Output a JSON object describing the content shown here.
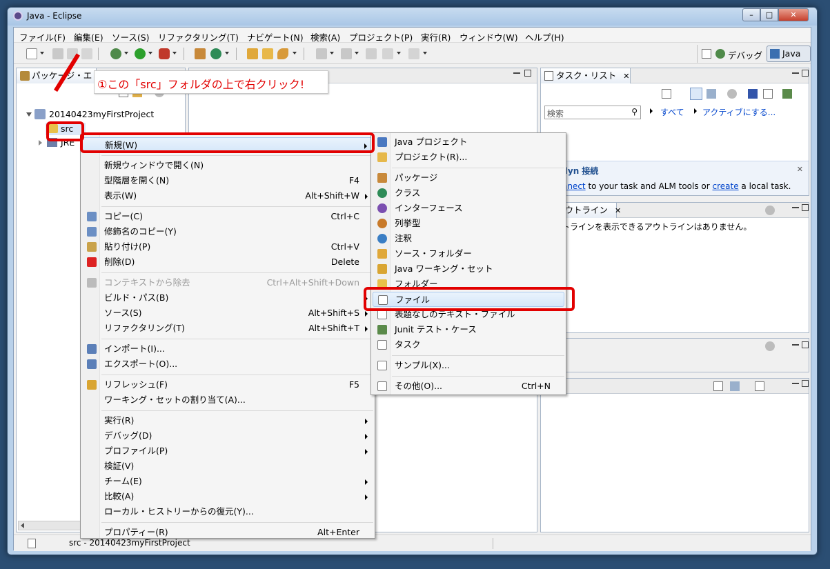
{
  "window": {
    "title": "Java - Eclipse",
    "minimize": "–",
    "maximize": "□",
    "close": "✕"
  },
  "menubar": [
    "ファイル(F)",
    "編集(E)",
    "ソース(S)",
    "リファクタリング(T)",
    "ナビゲート(N)",
    "検索(A)",
    "プロジェクト(P)",
    "実行(R)",
    "ウィンドウ(W)",
    "ヘルプ(H)"
  ],
  "perspectives": {
    "debug": "デバッグ",
    "java": "Java"
  },
  "package_explorer": {
    "tab": "パッケージ・エ",
    "project": "20140423myFirstProject",
    "src": "src",
    "jre": "JRE"
  },
  "annotation": {
    "text": "①この「src」フォルダの上で右クリック!"
  },
  "task_list": {
    "tab": "タスク・リスト",
    "search_placeholder": "検索",
    "all": "すべて",
    "activate": "アクティブにする...",
    "mylyn_title": "Mylyn 接続",
    "mylyn_connect": "Connect",
    "mylyn_text1": " to your task and ALM tools or ",
    "mylyn_create": "create",
    "mylyn_text2": " a local task."
  },
  "outline": {
    "tab": "アウトライン",
    "message": "アウトラインを表示できるアウトラインはありません。"
  },
  "context_menu": [
    {
      "label": "新規(W)",
      "shortcut": "",
      "arrow": true,
      "icon": "",
      "highlight": true
    },
    {
      "sep": true
    },
    {
      "label": "新規ウィンドウで開く(N)",
      "shortcut": ""
    },
    {
      "label": "型階層を開く(N)",
      "shortcut": "F4"
    },
    {
      "label": "表示(W)",
      "shortcut": "Alt+Shift+W",
      "arrow": true
    },
    {
      "sep": true
    },
    {
      "label": "コピー(C)",
      "shortcut": "Ctrl+C",
      "icon": "copy-icon"
    },
    {
      "label": "修飾名のコピー(Y)",
      "shortcut": "",
      "icon": "copy-qualified-icon"
    },
    {
      "label": "貼り付け(P)",
      "shortcut": "Ctrl+V",
      "icon": "paste-icon"
    },
    {
      "label": "削除(D)",
      "shortcut": "Delete",
      "icon": "delete-icon"
    },
    {
      "sep": true
    },
    {
      "label": "コンテキストから除去",
      "shortcut": "Ctrl+Alt+Shift+Down",
      "disabled": true,
      "icon": "remove-context-icon"
    },
    {
      "label": "ビルド・パス(B)",
      "shortcut": "",
      "arrow": true
    },
    {
      "label": "ソース(S)",
      "shortcut": "Alt+Shift+S",
      "arrow": true
    },
    {
      "label": "リファクタリング(T)",
      "shortcut": "Alt+Shift+T",
      "arrow": true
    },
    {
      "sep": true
    },
    {
      "label": "インポート(I)...",
      "shortcut": "",
      "icon": "import-icon"
    },
    {
      "label": "エクスポート(O)...",
      "shortcut": "",
      "icon": "export-icon"
    },
    {
      "sep": true
    },
    {
      "label": "リフレッシュ(F)",
      "shortcut": "F5",
      "icon": "refresh-icon"
    },
    {
      "label": "ワーキング・セットの割り当て(A)...",
      "shortcut": ""
    },
    {
      "sep": true
    },
    {
      "label": "実行(R)",
      "shortcut": "",
      "arrow": true
    },
    {
      "label": "デバッグ(D)",
      "shortcut": "",
      "arrow": true
    },
    {
      "label": "プロファイル(P)",
      "shortcut": "",
      "arrow": true
    },
    {
      "label": "検証(V)",
      "shortcut": ""
    },
    {
      "label": "チーム(E)",
      "shortcut": "",
      "arrow": true
    },
    {
      "label": "比較(A)",
      "shortcut": "",
      "arrow": true
    },
    {
      "label": "ローカル・ヒストリーからの復元(Y)...",
      "shortcut": ""
    },
    {
      "sep": true
    },
    {
      "label": "プロパティー(R)",
      "shortcut": "Alt+Enter"
    }
  ],
  "submenu": [
    {
      "label": "Java プロジェクト",
      "icon": "java-project-icon"
    },
    {
      "label": "プロジェクト(R)...",
      "icon": "project-icon"
    },
    {
      "sep": true
    },
    {
      "label": "パッケージ",
      "icon": "package-icon"
    },
    {
      "label": "クラス",
      "icon": "class-icon"
    },
    {
      "label": "インターフェース",
      "icon": "interface-icon"
    },
    {
      "label": "列挙型",
      "icon": "enum-icon"
    },
    {
      "label": "注釈",
      "icon": "annotation-icon"
    },
    {
      "label": "ソース・フォルダー",
      "icon": "source-folder-icon"
    },
    {
      "label": "Java ワーキング・セット",
      "icon": "working-set-icon"
    },
    {
      "label": "フォルダー",
      "icon": "folder-icon"
    },
    {
      "label": "ファイル",
      "icon": "file-icon",
      "highlight": true
    },
    {
      "label": "表題なしのテキスト・ファイル",
      "icon": "text-file-icon"
    },
    {
      "label": "Junit テスト・ケース",
      "icon": "junit-icon"
    },
    {
      "label": "タスク",
      "icon": "task-icon"
    },
    {
      "sep": true
    },
    {
      "label": "サンプル(X)...",
      "icon": "sample-icon"
    },
    {
      "sep": true
    },
    {
      "label": "その他(O)...",
      "shortcut": "Ctrl+N",
      "icon": "other-icon"
    }
  ],
  "statusbar": {
    "text": "src - 20140423myFirstProject"
  },
  "colors": {
    "annotation_red": "#e20000",
    "highlight": "#d6e7fa"
  }
}
